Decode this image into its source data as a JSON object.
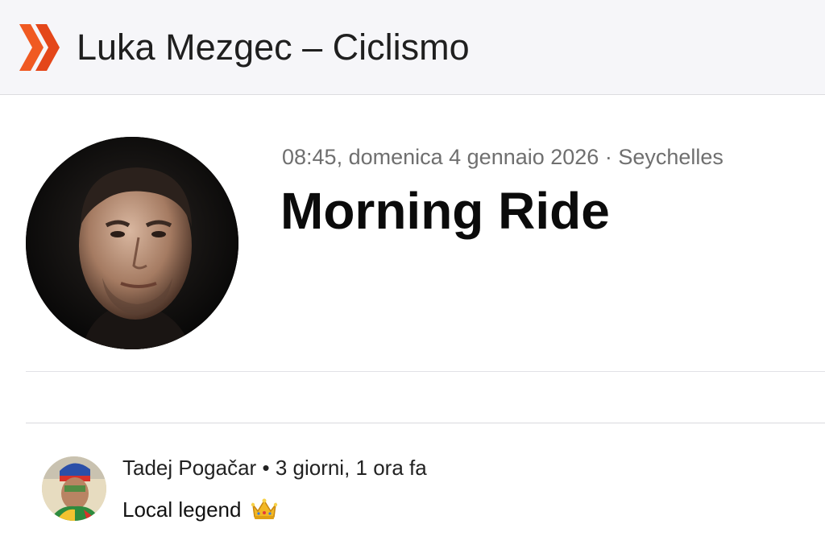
{
  "header": {
    "title": "Luka Mezgec – Ciclismo",
    "logo_icon": "double-chevron-icon",
    "logo_color": "#f05a22"
  },
  "activity": {
    "meta": "08:45, domenica 4 gennaio 2026 · Seychelles",
    "title": "Morning Ride",
    "athlete_avatar": "athlete-avatar"
  },
  "comment": {
    "author": "Tadej Pogačar",
    "separator": "•",
    "time_ago": "3 giorni, 1 ora fa",
    "text": "Local legend",
    "emoji_icon": "crown-icon"
  }
}
